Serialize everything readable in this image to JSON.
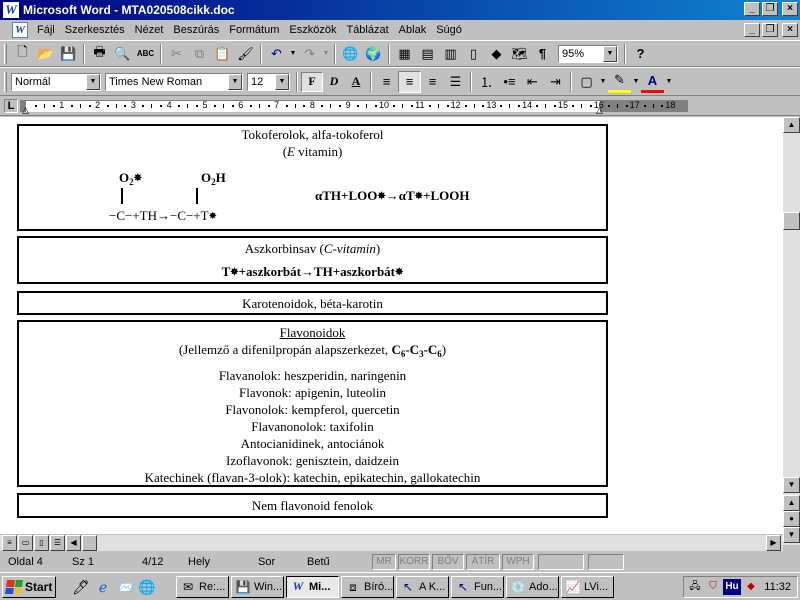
{
  "window": {
    "title": "Microsoft Word - MTA020508cikk.doc"
  },
  "menu": [
    "Fájl",
    "Szerkesztés",
    "Nézet",
    "Beszúrás",
    "Formátum",
    "Eszközök",
    "Táblázat",
    "Ablak",
    "Súgó"
  ],
  "toolbar": {
    "zoom": "95%"
  },
  "format": {
    "style": "Normál",
    "font": "Times New Roman",
    "size": "12"
  },
  "ruler": {
    "numbers": [
      "1",
      "2",
      "3",
      "4",
      "5",
      "6",
      "7",
      "8",
      "9",
      "10",
      "11",
      "12",
      "13",
      "14",
      "15",
      "16",
      "17",
      "18"
    ]
  },
  "document": {
    "box1": {
      "title": "Tokoferolok, alfa-tokoferol",
      "sub_open": "(",
      "sub_italic": "E",
      "sub_rest": " vitamin)",
      "o2_left": "O",
      "o2_right": "O",
      "o2_sub": "2",
      "h": "H",
      "radical": "✸",
      "react_left": "−C−+TH→−C−+T",
      "react_right_1": "αTH+LOO",
      "react_right_2": "→αT",
      "react_right_3": "+LOOH"
    },
    "box2": {
      "title_plain": "Aszkorbinsav (",
      "title_italic": "C-vitamin",
      "title_close": ")",
      "react_1": "T",
      "react_2": "+aszkorbát→TH+aszkorbát"
    },
    "box3": {
      "title": "Karotenoidok, béta-karotin"
    },
    "box4": {
      "title": "Flavonoidok",
      "subtitle": "(Jellemző a difenilpropán alapszerkezet, ",
      "formula_c": "C",
      "formula_6": "6",
      "formula_3": "3",
      "formula_dash": "-",
      "subtitle_close": ")",
      "lines": [
        "Flavanolok: heszperidin, naringenin",
        "Flavonok: apigenin, luteolin",
        "Flavonolok: kempferol, quercetin",
        "Flavanonolok: taxifolin",
        "Antocianidinek, antociánok",
        "Izoflavonok: genisztein, daidzein",
        "Katechinek (flavan-3-olok): katechin, epikatechin, gallokatechin"
      ]
    },
    "box5": {
      "title": "Nem flavonoid fenolok"
    }
  },
  "status": {
    "page": "Oldal  4",
    "section": "Sz  1",
    "pages": "4/12",
    "at": "Hely",
    "line": "Sor",
    "col": "Betű",
    "indicators": [
      "MR",
      "KORR",
      "BŐV",
      "ÁTÍR",
      "WPH"
    ]
  },
  "taskbar": {
    "start": "Start",
    "tasks": [
      {
        "label": "Re:...",
        "icon": "envelope"
      },
      {
        "label": "Win...",
        "icon": "disk"
      },
      {
        "label": "Mi...",
        "icon": "word"
      },
      {
        "label": "Bíró...",
        "icon": "puzzle"
      },
      {
        "label": "A K...",
        "icon": "arrow"
      },
      {
        "label": "Fun...",
        "icon": "arrow"
      },
      {
        "label": "Ado...",
        "icon": "cd"
      },
      {
        "label": "LVi...",
        "icon": "chart"
      }
    ],
    "tray": {
      "lang": "Hu",
      "clock": "11:32"
    }
  }
}
